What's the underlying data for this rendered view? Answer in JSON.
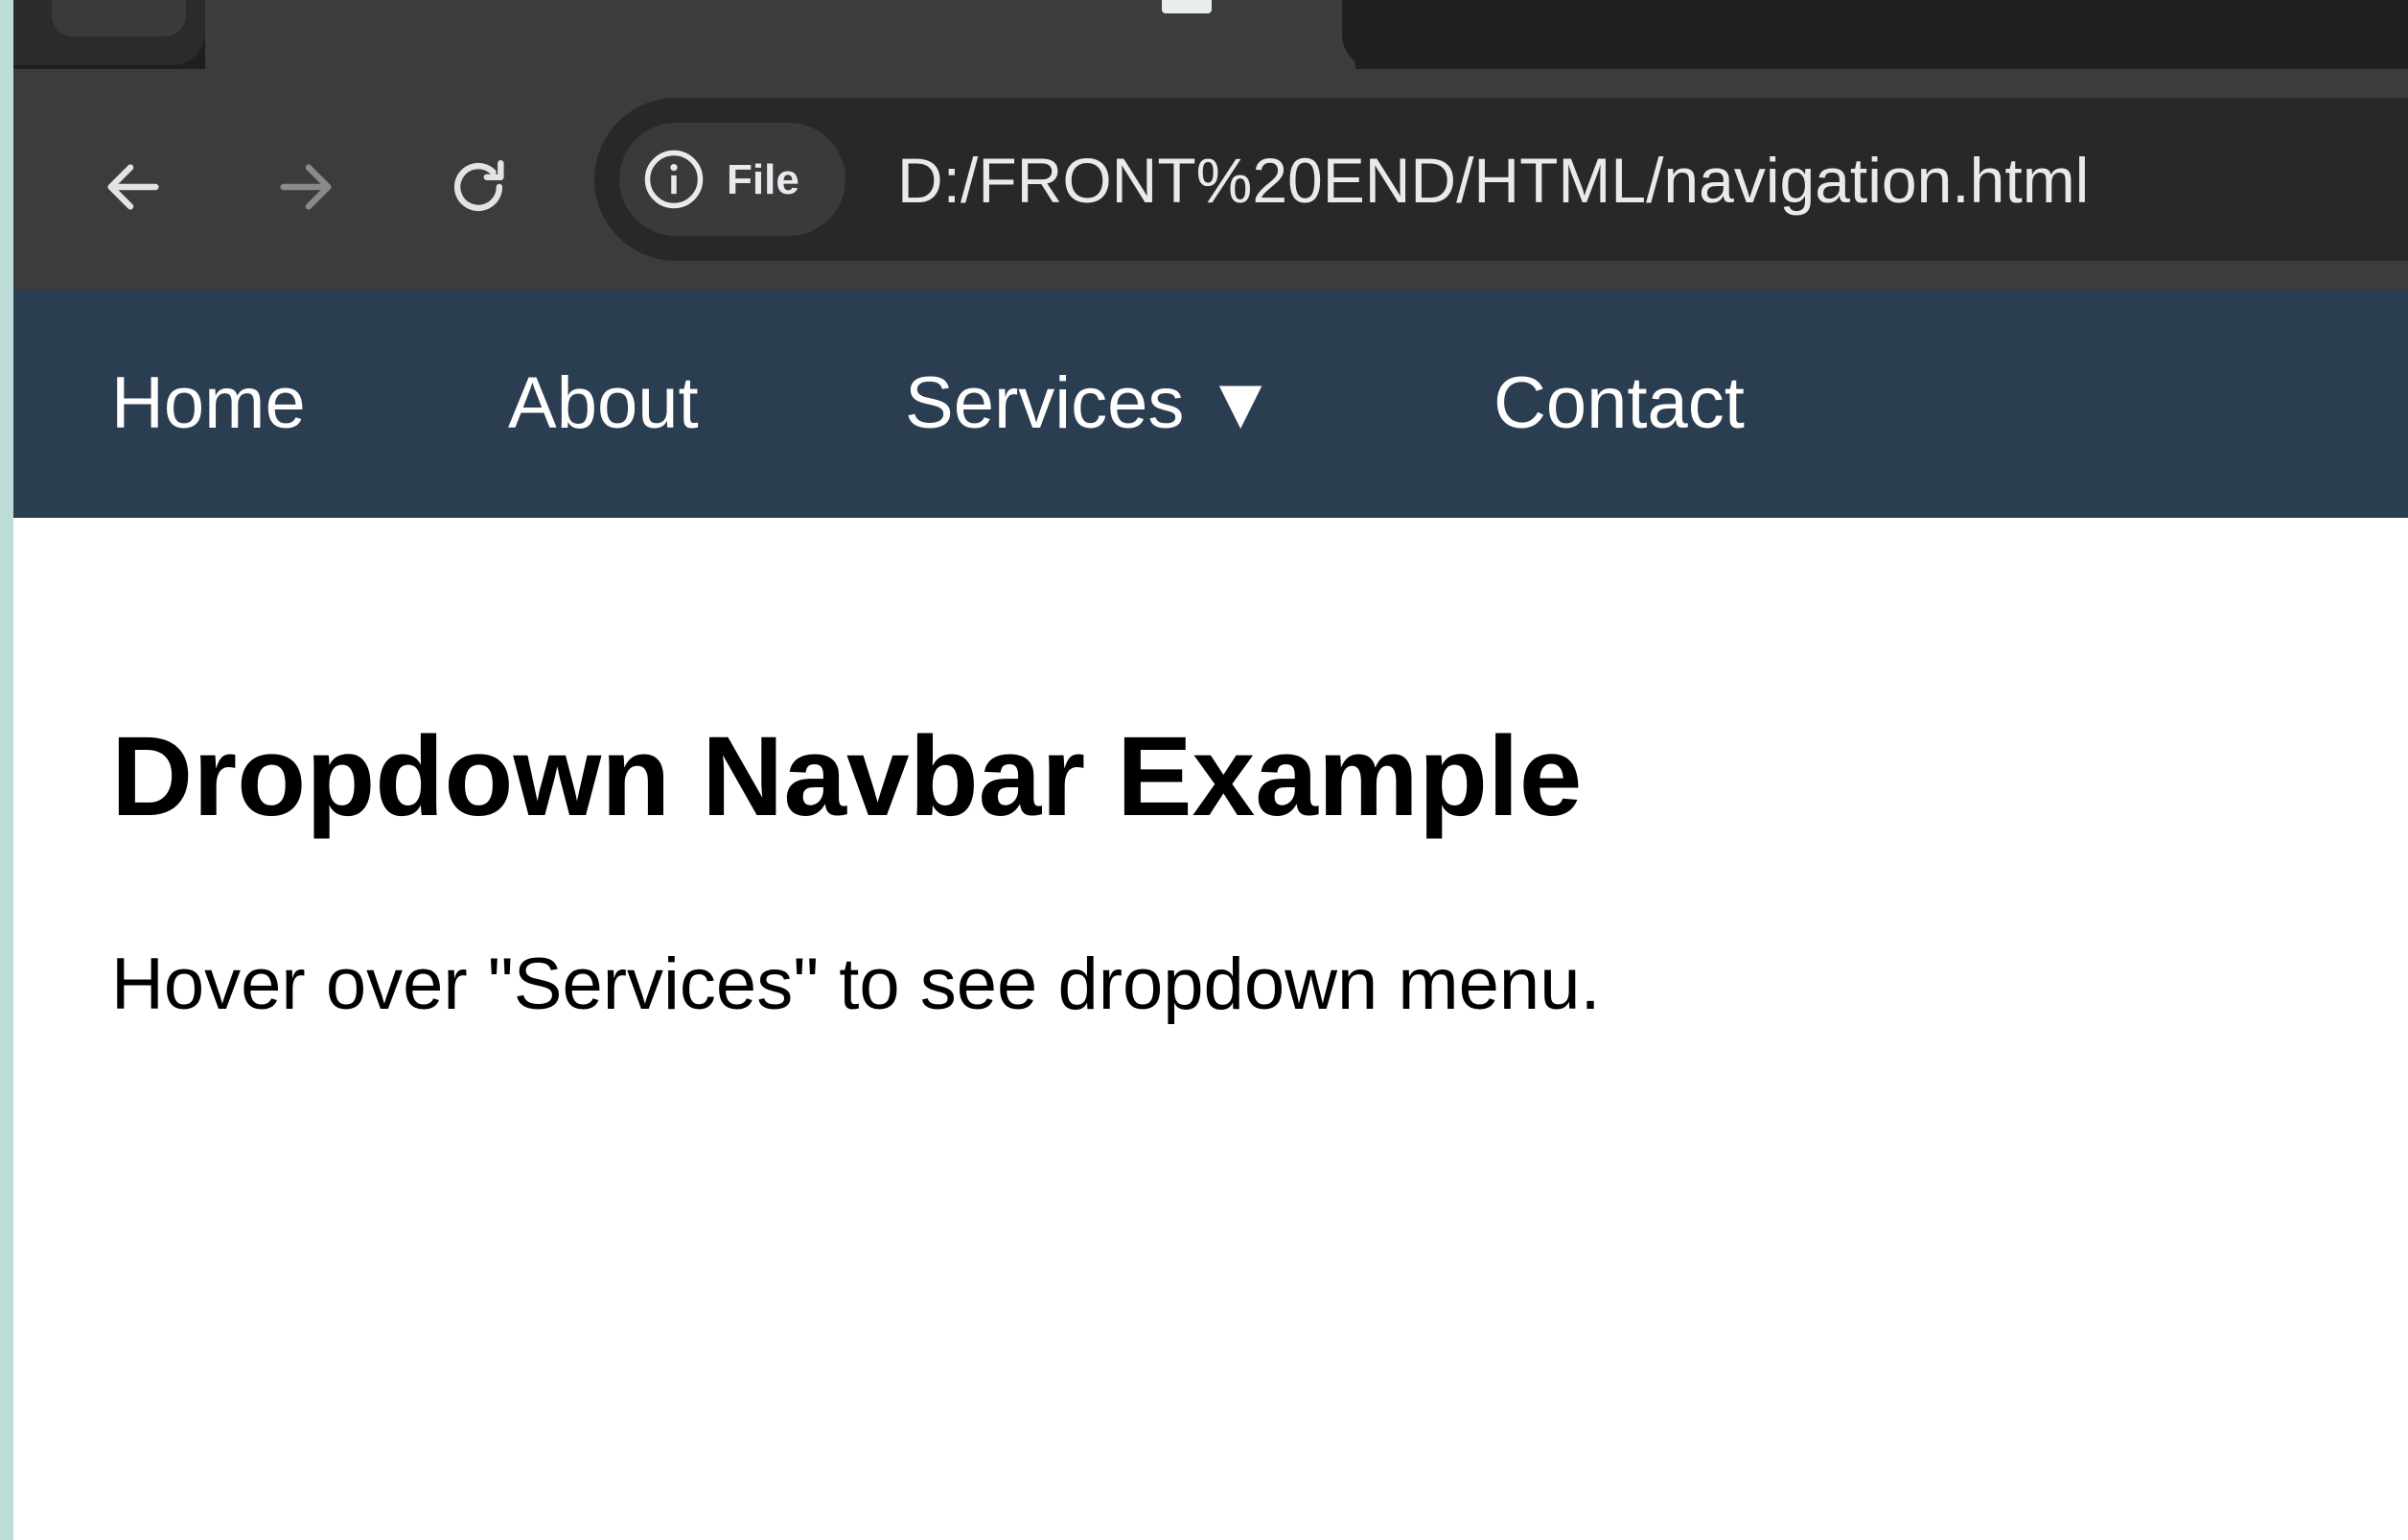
{
  "browser": {
    "omnibox": {
      "chip_label": "File",
      "url": "D:/FRONT%20END/HTML/navigation.html"
    }
  },
  "navbar": {
    "items": [
      {
        "label": "Home"
      },
      {
        "label": "About"
      },
      {
        "label": "Services ▼"
      },
      {
        "label": "Contact"
      }
    ]
  },
  "page": {
    "title": "Dropdown Navbar Example",
    "text": "Hover over \"Services\" to see dropdown menu."
  },
  "colors": {
    "navbar_bg": "#2b3d50",
    "toolbar_bg": "#3c3c3c",
    "omnibox_bg": "#282828"
  }
}
